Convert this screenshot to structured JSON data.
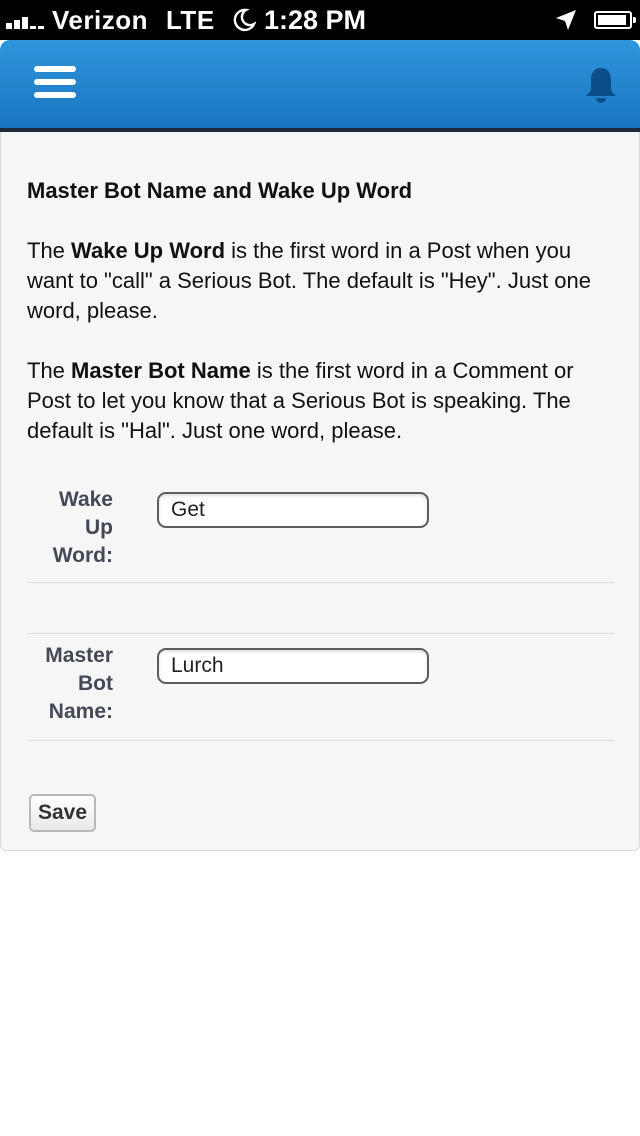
{
  "status_bar": {
    "carrier": "Verizon",
    "network": "LTE",
    "time": "1:28 PM",
    "icons": [
      "signal-bars-icon",
      "moon-icon",
      "location-arrow-icon",
      "battery-icon"
    ]
  },
  "header": {
    "brand_color": "#1f80c9",
    "icons": [
      "hamburger-menu-icon",
      "bell-icon"
    ]
  },
  "content": {
    "section_title": "Master Bot Name and Wake Up Word",
    "para1": {
      "prefix": "The ",
      "bold": "Wake Up Word",
      "suffix": " is the first word in a Post when you want to \"call\" a Serious Bot. The default is \"Hey\". Just one word, please."
    },
    "para2": {
      "prefix": "The ",
      "bold": "Master Bot Name",
      "suffix": " is the first word in a Comment or Post to let you know that a Serious Bot is speaking. The default is \"Hal\". Just one word, please."
    }
  },
  "form": {
    "wake_word": {
      "label_lines": [
        "Wake",
        "Up",
        "Word:"
      ],
      "value": "Get"
    },
    "master_name": {
      "label_lines": [
        "Master",
        "Bot",
        "Name:"
      ],
      "value": "Lurch"
    },
    "save_label": "Save"
  }
}
